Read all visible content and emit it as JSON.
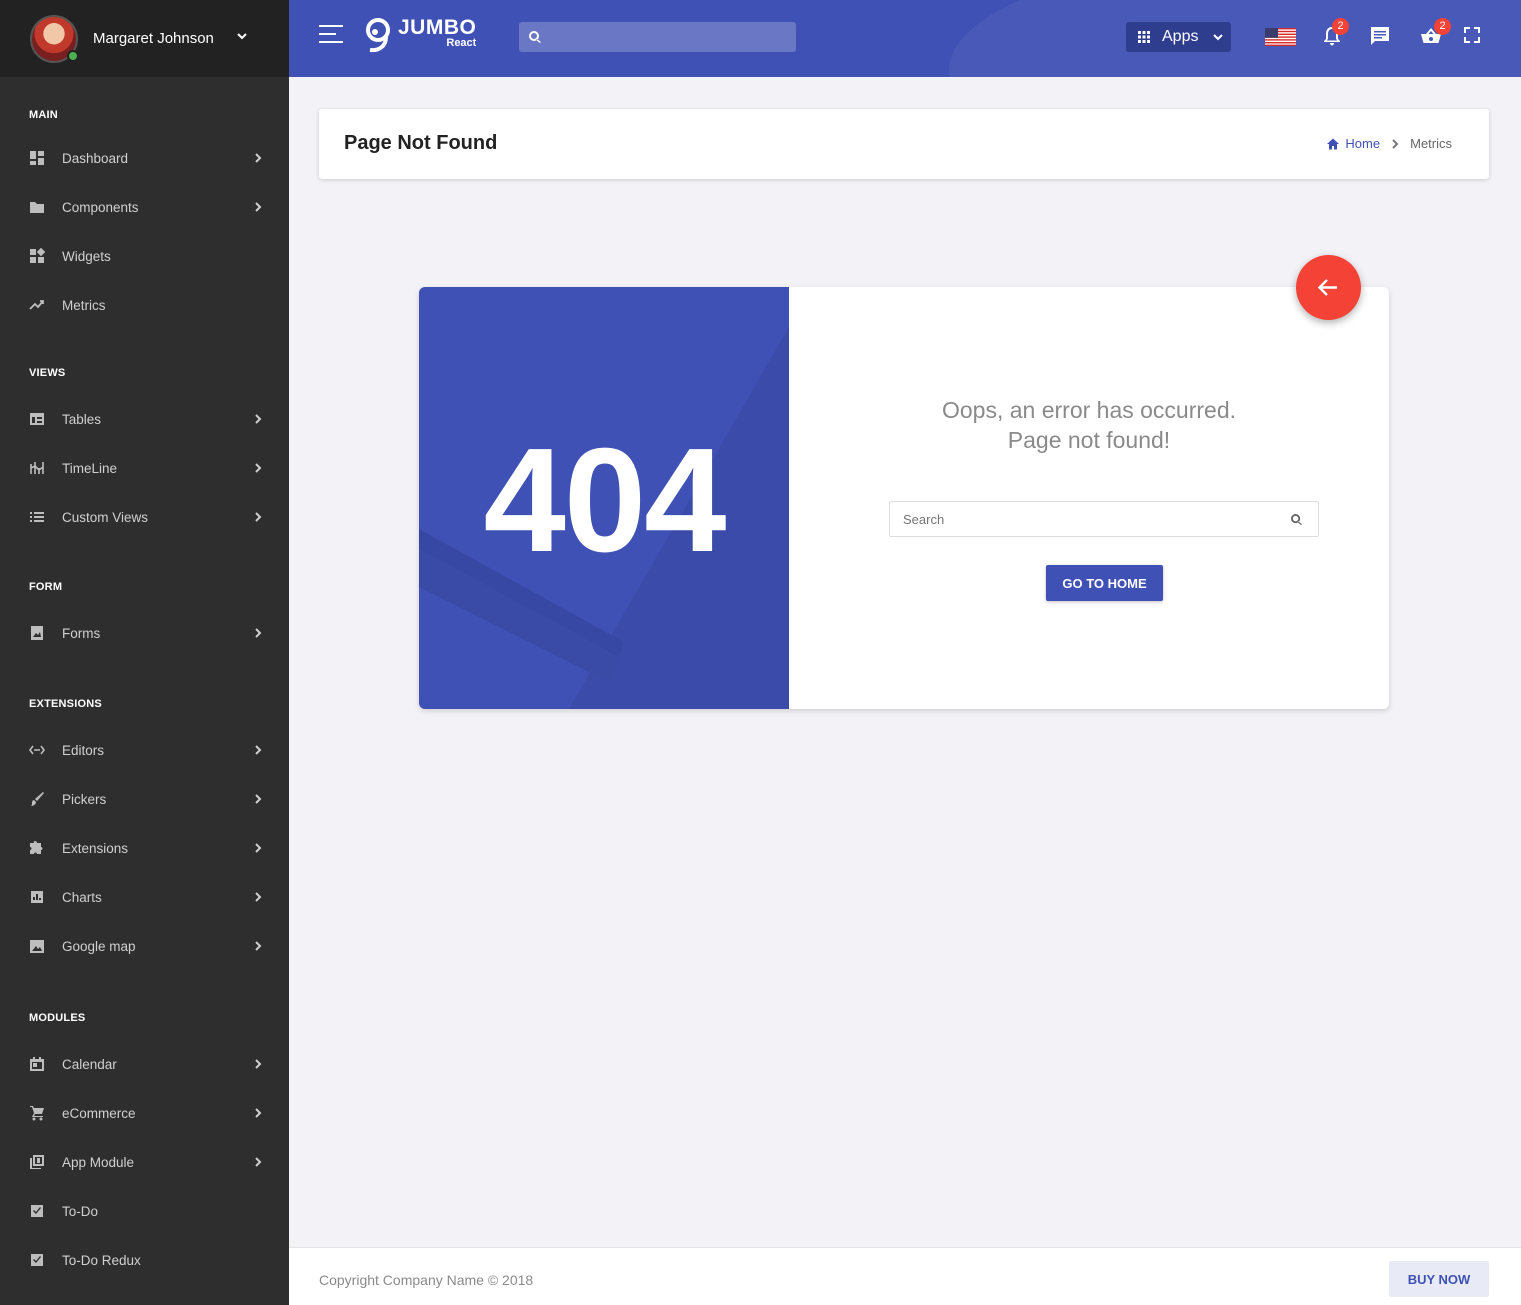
{
  "user": {
    "name": "Margaret Johnson"
  },
  "sidebar": {
    "sections": [
      {
        "label": "MAIN"
      },
      {
        "label": "VIEWS"
      },
      {
        "label": "FORM"
      },
      {
        "label": "EXTENSIONS"
      },
      {
        "label": "MODULES"
      }
    ],
    "items": [
      {
        "label": "Dashboard",
        "icon": "dashboard-icon"
      },
      {
        "label": "Components",
        "icon": "folder-icon"
      },
      {
        "label": "Widgets",
        "icon": "widgets-icon"
      },
      {
        "label": "Metrics",
        "icon": "trending-up-icon"
      },
      {
        "label": "Tables",
        "icon": "table-icon"
      },
      {
        "label": "TimeLine",
        "icon": "timeline-icon"
      },
      {
        "label": "Custom Views",
        "icon": "list-icon"
      },
      {
        "label": "Forms",
        "icon": "form-icon"
      },
      {
        "label": "Editors",
        "icon": "code-icon"
      },
      {
        "label": "Pickers",
        "icon": "brush-icon"
      },
      {
        "label": "Extensions",
        "icon": "puzzle-icon"
      },
      {
        "label": "Charts",
        "icon": "chart-icon"
      },
      {
        "label": "Google map",
        "icon": "map-icon"
      },
      {
        "label": "Calendar",
        "icon": "calendar-icon"
      },
      {
        "label": "eCommerce",
        "icon": "cart-icon"
      },
      {
        "label": "App Module",
        "icon": "library-icon"
      },
      {
        "label": "To-Do",
        "icon": "checkbox-icon"
      },
      {
        "label": "To-Do Redux",
        "icon": "checkbox-icon"
      }
    ]
  },
  "header": {
    "logo_main": "JUMBO",
    "logo_sub": "React",
    "search_placeholder": "",
    "apps_label": "Apps",
    "notifications_count": "2",
    "cart_count": "2"
  },
  "page": {
    "title": "Page Not Found",
    "breadcrumb": {
      "home": "Home",
      "current": "Metrics"
    }
  },
  "error": {
    "code": "404",
    "message_line1": "Oops, an error has occurred.",
    "message_line2": "Page not found!",
    "search_placeholder": "Search",
    "button_label": "GO TO HOME"
  },
  "footer": {
    "copyright": "Copyright Company Name © 2018",
    "buy_label": "BUY NOW"
  },
  "colors": {
    "primary": "#3f51b5",
    "accent": "#f44336",
    "sidebar": "#2e2e2e",
    "online": "#4caf50"
  }
}
